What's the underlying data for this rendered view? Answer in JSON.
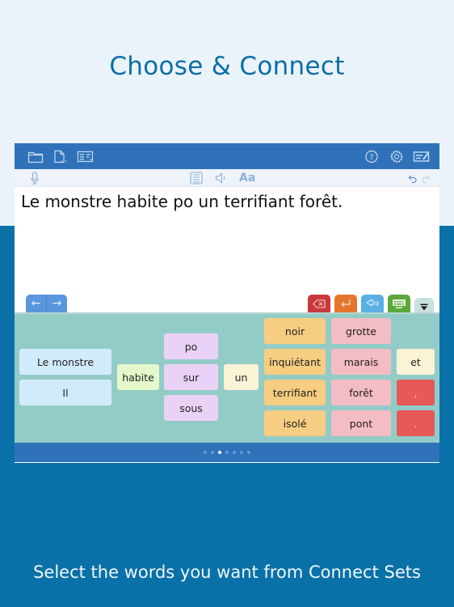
{
  "headline": "Choose & Connect",
  "footer": "Select the words you want from Connect Sets",
  "toolbar": {
    "left_icons": [
      "folder-icon",
      "new-document-icon",
      "layout-icon"
    ],
    "right_icons": [
      "help-icon",
      "settings-icon",
      "edit-mode-icon"
    ]
  },
  "subbar": {
    "left_icons": [
      "microphone-icon"
    ],
    "center_icons": [
      "word-list-icon",
      "speaker-icon",
      "font-icon"
    ],
    "font_label": "Aa",
    "right_icons": [
      "undo-icon",
      "redo-icon"
    ]
  },
  "editor": {
    "sentence": "Le monstre habite po un terrifiant forêt."
  },
  "tabs": {
    "nav_prev": "←",
    "nav_next": "→",
    "actions": [
      {
        "name": "backspace",
        "color": "#c9393c"
      },
      {
        "name": "enter",
        "color": "#e5762f"
      },
      {
        "name": "speak",
        "color": "#5ab0e3"
      },
      {
        "name": "keyboard",
        "color": "#5ba83b"
      },
      {
        "name": "collapse",
        "color": "#c8e1de"
      }
    ]
  },
  "connect_set": {
    "subjects": [
      "Le monstre",
      "Il"
    ],
    "verbs": [
      "habite"
    ],
    "prepositions": [
      "po",
      "sur",
      "sous"
    ],
    "articles": [
      "un"
    ],
    "adjectives": [
      "noir",
      "inquiétant",
      "terrifiant",
      "isolé"
    ],
    "nouns": [
      "grotte",
      "marais",
      "forêt",
      "pont"
    ],
    "conjunctions": [
      "et"
    ],
    "punctuation": [
      ",",
      "."
    ]
  },
  "pager": {
    "total": 7,
    "current": 3
  },
  "colors": {
    "brand_blue": "#2f72b9",
    "page_blue": "#0a71a8",
    "panel_teal": "#93ccc7"
  }
}
